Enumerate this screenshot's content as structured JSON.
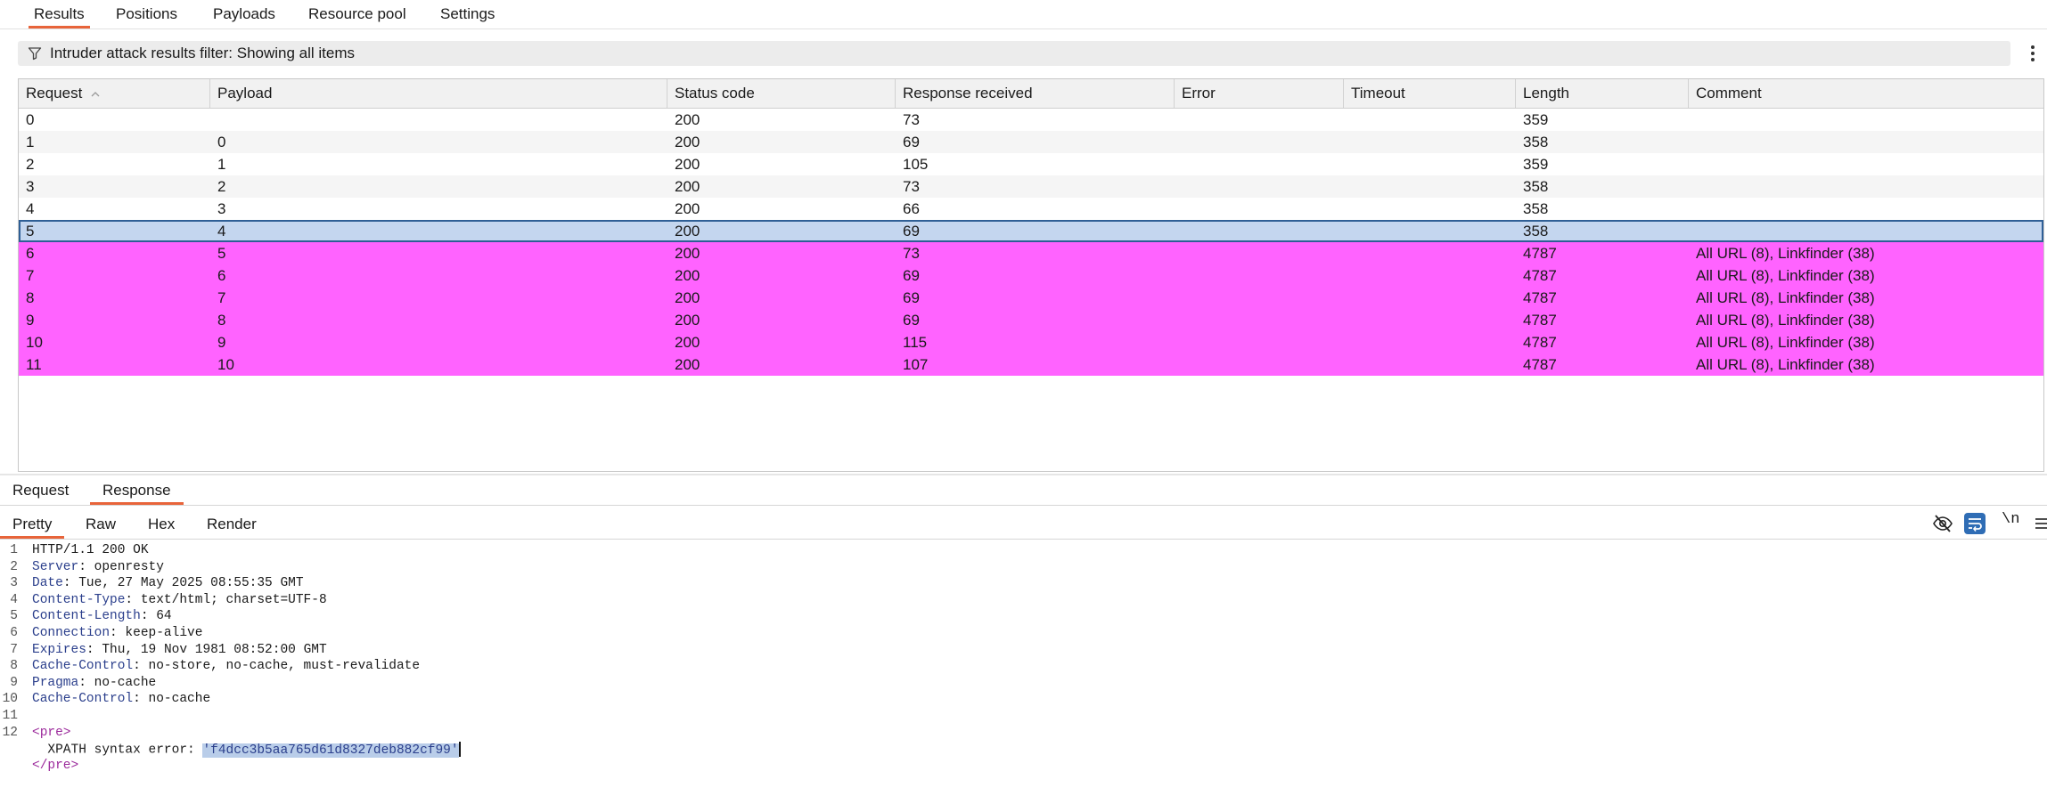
{
  "top_tabs": [
    "Results",
    "Positions",
    "Payloads",
    "Resource pool",
    "Settings"
  ],
  "filter": {
    "text": "Intruder attack results filter: Showing all items"
  },
  "table": {
    "columns": [
      "Request",
      "Payload",
      "Status code",
      "Response received",
      "Error",
      "Timeout",
      "Length",
      "Comment"
    ],
    "sorted_column": "Request",
    "rows": [
      {
        "request": "0",
        "payload": "",
        "status": "200",
        "response": "73",
        "error": "",
        "timeout": "",
        "length": "359",
        "comment": "",
        "style": "plain"
      },
      {
        "request": "1",
        "payload": "0",
        "status": "200",
        "response": "69",
        "error": "",
        "timeout": "",
        "length": "358",
        "comment": "",
        "style": "alt"
      },
      {
        "request": "2",
        "payload": "1",
        "status": "200",
        "response": "105",
        "error": "",
        "timeout": "",
        "length": "359",
        "comment": "",
        "style": "plain"
      },
      {
        "request": "3",
        "payload": "2",
        "status": "200",
        "response": "73",
        "error": "",
        "timeout": "",
        "length": "358",
        "comment": "",
        "style": "alt"
      },
      {
        "request": "4",
        "payload": "3",
        "status": "200",
        "response": "66",
        "error": "",
        "timeout": "",
        "length": "358",
        "comment": "",
        "style": "plain"
      },
      {
        "request": "5",
        "payload": "4",
        "status": "200",
        "response": "69",
        "error": "",
        "timeout": "",
        "length": "358",
        "comment": "",
        "style": "selected"
      },
      {
        "request": "6",
        "payload": "5",
        "status": "200",
        "response": "73",
        "error": "",
        "timeout": "",
        "length": "4787",
        "comment": "All URL (8), Linkfinder (38)",
        "style": "highlight"
      },
      {
        "request": "7",
        "payload": "6",
        "status": "200",
        "response": "69",
        "error": "",
        "timeout": "",
        "length": "4787",
        "comment": "All URL (8), Linkfinder (38)",
        "style": "highlight"
      },
      {
        "request": "8",
        "payload": "7",
        "status": "200",
        "response": "69",
        "error": "",
        "timeout": "",
        "length": "4787",
        "comment": "All URL (8), Linkfinder (38)",
        "style": "highlight"
      },
      {
        "request": "9",
        "payload": "8",
        "status": "200",
        "response": "69",
        "error": "",
        "timeout": "",
        "length": "4787",
        "comment": "All URL (8), Linkfinder (38)",
        "style": "highlight"
      },
      {
        "request": "10",
        "payload": "9",
        "status": "200",
        "response": "115",
        "error": "",
        "timeout": "",
        "length": "4787",
        "comment": "All URL (8), Linkfinder (38)",
        "style": "highlight"
      },
      {
        "request": "11",
        "payload": "10",
        "status": "200",
        "response": "107",
        "error": "",
        "timeout": "",
        "length": "4787",
        "comment": "All URL (8), Linkfinder (38)",
        "style": "highlight"
      }
    ]
  },
  "message_tabs": [
    "Request",
    "Response"
  ],
  "view_tabs": [
    "Pretty",
    "Raw",
    "Hex",
    "Render"
  ],
  "toolbar_icons": [
    "hide-icon",
    "wrap-icon",
    "newline-icon",
    "menu-icon"
  ],
  "toolbar_newline_label": "\\n",
  "response_lines": [
    {
      "n": "1",
      "key": "",
      "text": "HTTP/1.1 200 OK"
    },
    {
      "n": "2",
      "key": "Server",
      "text": "openresty"
    },
    {
      "n": "3",
      "key": "Date",
      "text": "Tue, 27 May 2025 08:55:35 GMT"
    },
    {
      "n": "4",
      "key": "Content-Type",
      "text": "text/html; charset=UTF-8"
    },
    {
      "n": "5",
      "key": "Content-Length",
      "text": "64"
    },
    {
      "n": "6",
      "key": "Connection",
      "text": "keep-alive"
    },
    {
      "n": "7",
      "key": "Expires",
      "text": "Thu, 19 Nov 1981 08:52:00 GMT"
    },
    {
      "n": "8",
      "key": "Cache-Control",
      "text": "no-store, no-cache, must-revalidate"
    },
    {
      "n": "9",
      "key": "Pragma",
      "text": "no-cache"
    },
    {
      "n": "10",
      "key": "Cache-Control",
      "text": "no-cache"
    },
    {
      "n": "11",
      "key": "",
      "text": ""
    },
    {
      "n": "12",
      "key": "",
      "text": "<pre>"
    },
    {
      "n": "",
      "key": "",
      "text": "  XPATH syntax error: ",
      "selected": "'f4dcc3b5aa765d61d8327deb882cf99'"
    },
    {
      "n": "",
      "key": "",
      "text": "</pre>"
    }
  ],
  "colors": {
    "accent": "#e8643a",
    "highlight": "#ff63ff",
    "selected_row": "#c4d6ef",
    "header_key": "#2b3f8c",
    "tag": "#9c2b9c"
  }
}
